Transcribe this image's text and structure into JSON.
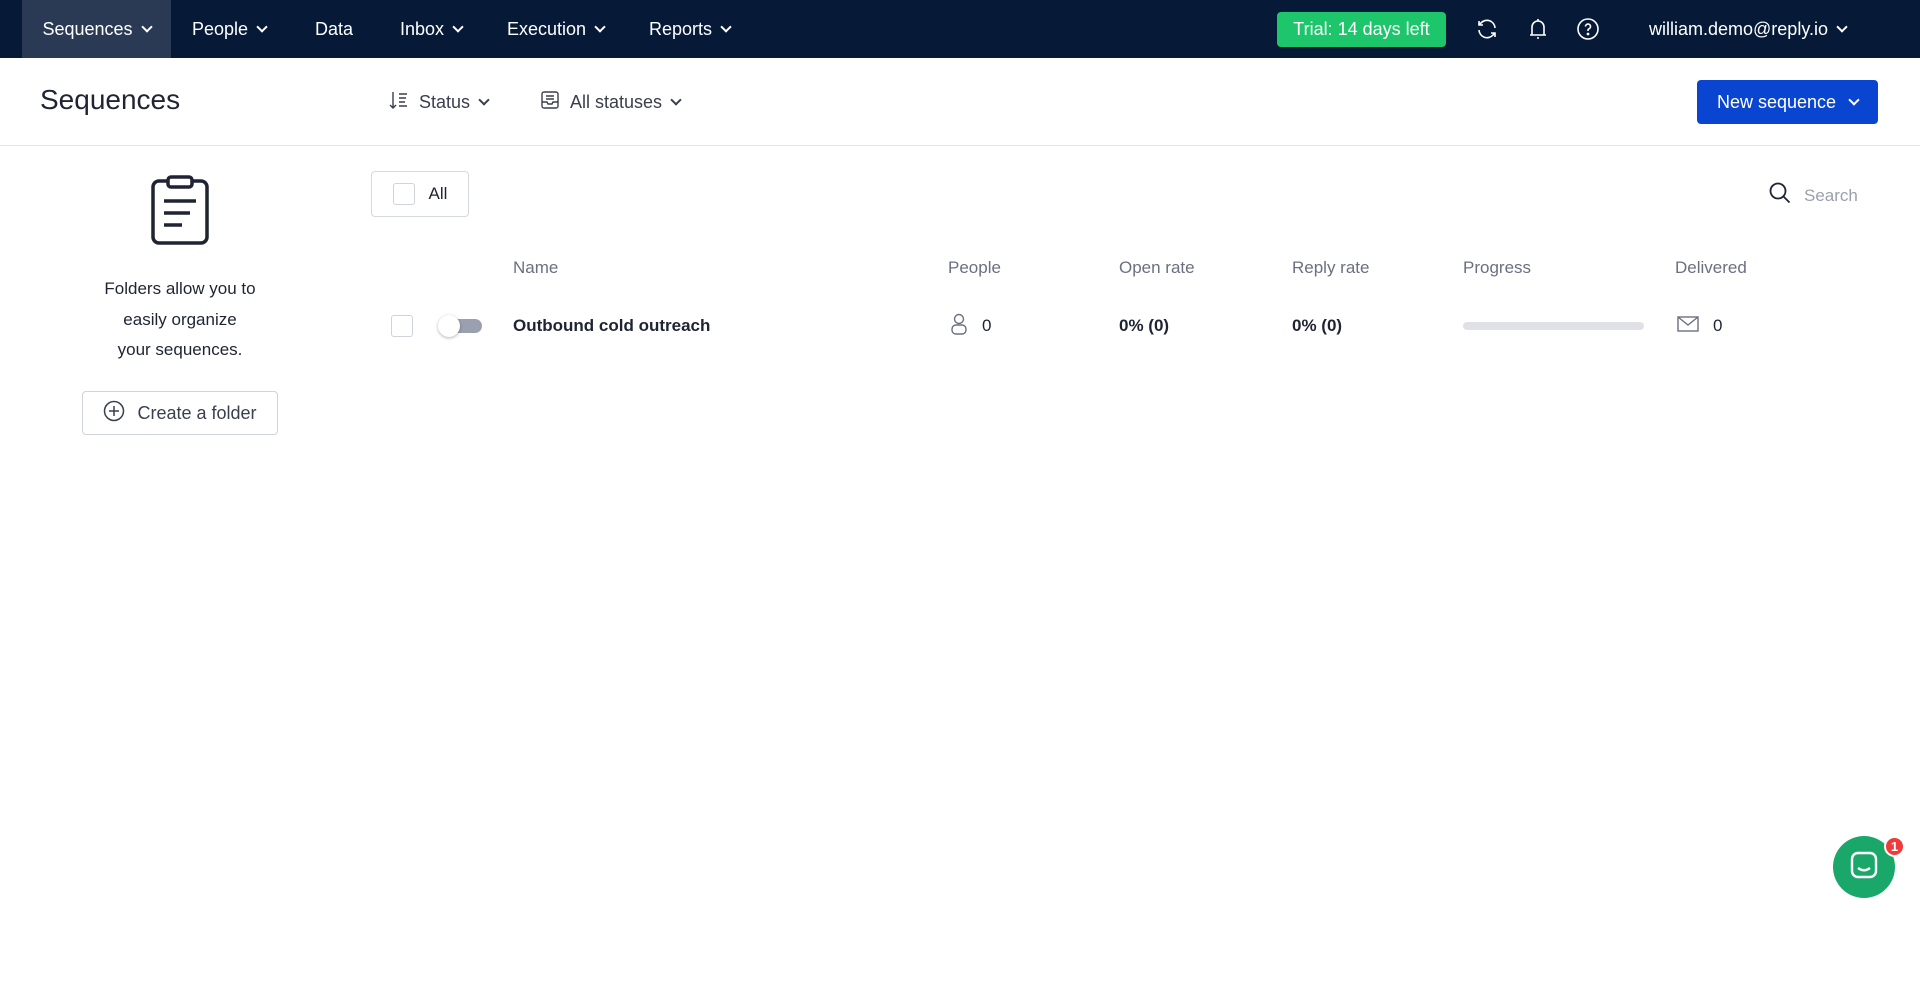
{
  "nav": {
    "items": [
      {
        "label": "Sequences",
        "dropdown": true
      },
      {
        "label": "People",
        "dropdown": true
      },
      {
        "label": "Data",
        "dropdown": false
      },
      {
        "label": "Inbox",
        "dropdown": true
      },
      {
        "label": "Execution",
        "dropdown": true
      },
      {
        "label": "Reports",
        "dropdown": true
      }
    ],
    "trial": "Trial: 14 days left",
    "user": "william.demo@reply.io"
  },
  "header": {
    "title": "Sequences",
    "sort_label": "Status",
    "status_filter": "All statuses",
    "new_button": "New sequence"
  },
  "sidebar": {
    "lines": [
      "Folders allow you to",
      "easily organize",
      "your sequences."
    ],
    "create_folder": "Create a folder"
  },
  "toolbar": {
    "select_all": "All",
    "search_placeholder": "Search"
  },
  "table": {
    "columns": [
      "Name",
      "People",
      "Open rate",
      "Reply rate",
      "Progress",
      "Delivered"
    ],
    "rows": [
      {
        "name": "Outbound cold outreach",
        "people": "0",
        "open_rate": "0% (0)",
        "reply_rate": "0% (0)",
        "progress": 0,
        "delivered": "0",
        "active": false
      }
    ]
  },
  "chat": {
    "badge": "1"
  },
  "colors": {
    "nav": "#061a38",
    "trial": "#1ec66b",
    "primary": "#0a45d1",
    "chat": "#1aa86a"
  }
}
